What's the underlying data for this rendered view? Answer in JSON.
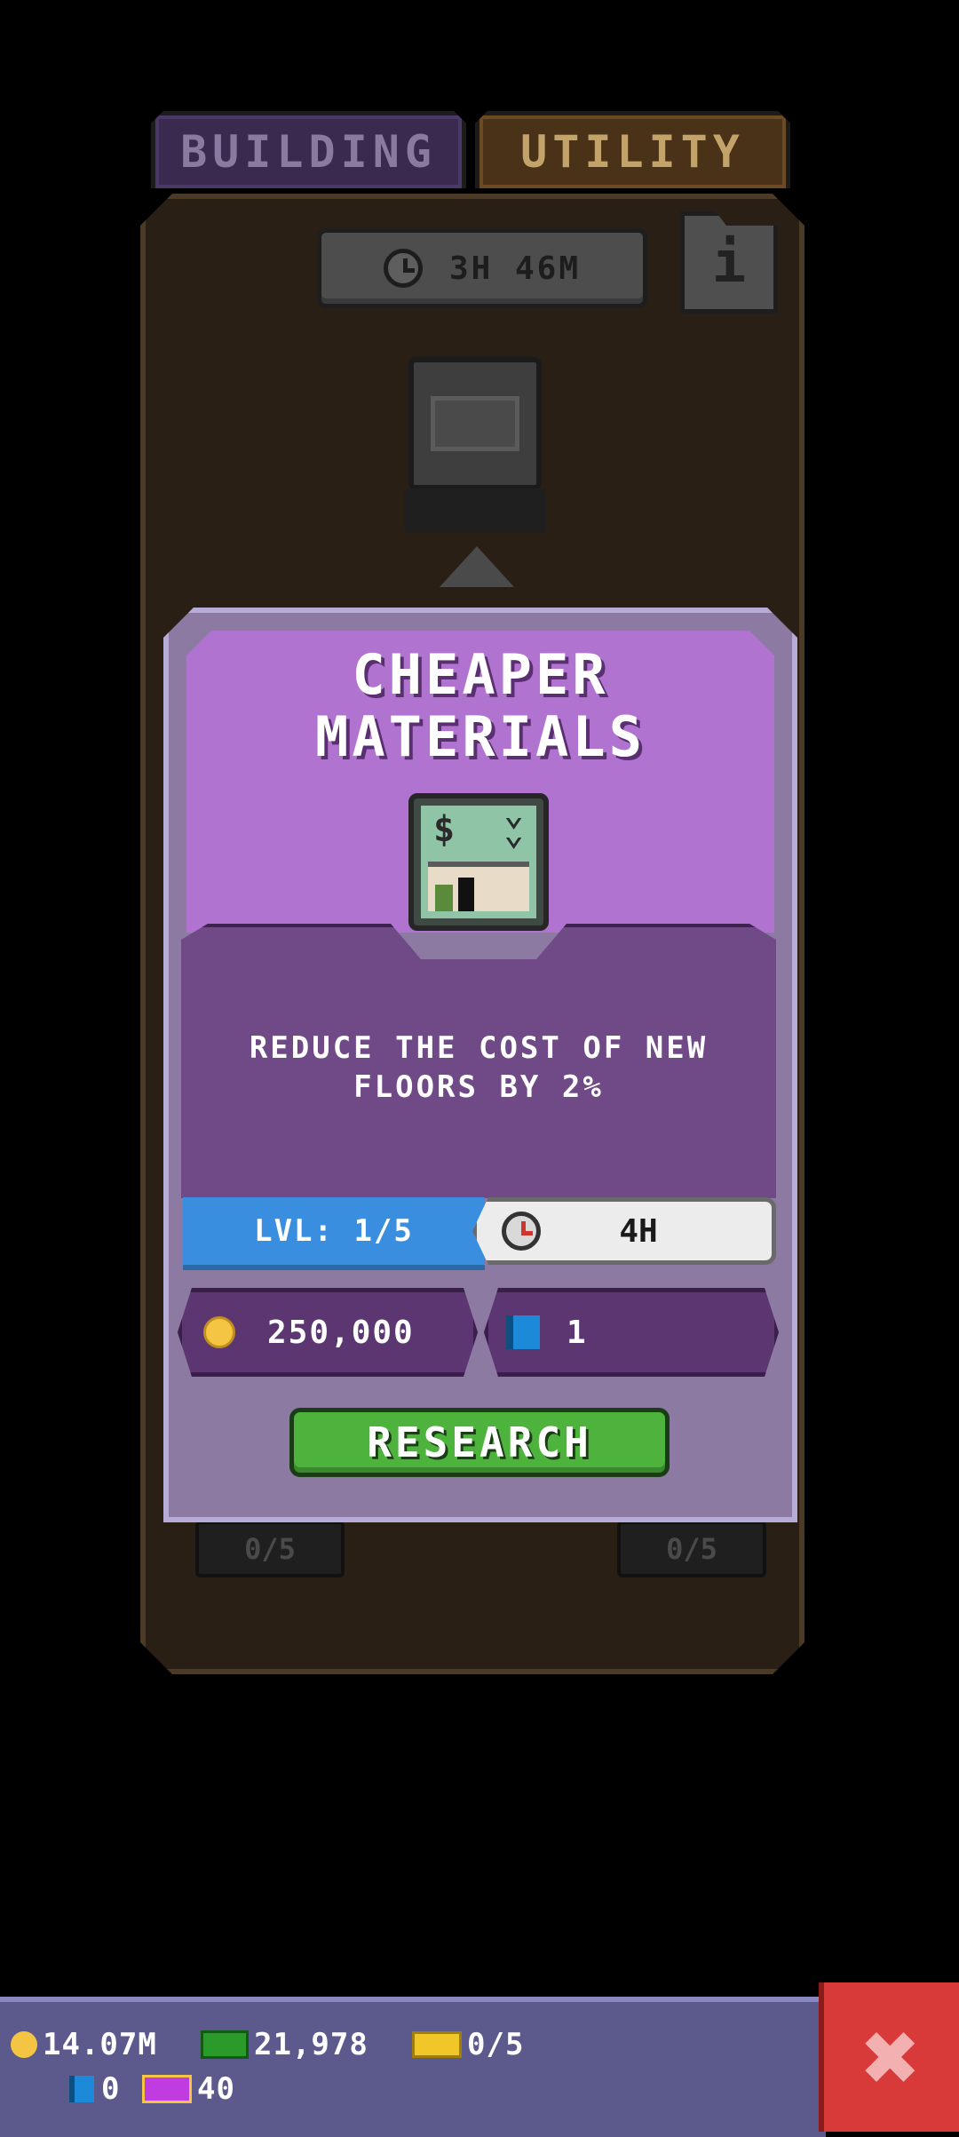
{
  "tabs": {
    "building": "BUILDING",
    "utility": "UTILITY"
  },
  "panel": {
    "timer": "3H 46M",
    "info": "i",
    "left_count": "0/5",
    "right_count": "0/5"
  },
  "card": {
    "title_line1": "CHEAPER",
    "title_line2": "MATERIALS",
    "desc_line1": "REDUCE THE COST OF NEW",
    "desc_line2": "FLOORS BY 2%",
    "icon": "cheaper-materials-icon",
    "level": "LVL: 1/5",
    "duration": "4H",
    "cost_coins": "250,000",
    "cost_books": "1",
    "research_label": "RESEARCH"
  },
  "bottom": {
    "coins": "14.07M",
    "bux": "21,978",
    "tickets": "0/5",
    "books": "0",
    "gems": "40",
    "close": "✖"
  }
}
